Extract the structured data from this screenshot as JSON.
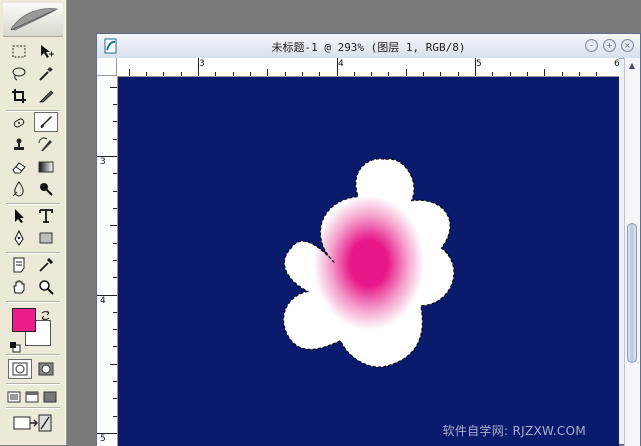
{
  "document": {
    "title": "未标题-1 @ 293% (图层 1, RGB/8)",
    "ruler_h_labels": [
      "3",
      "4",
      "5",
      "6"
    ],
    "ruler_v_labels": [
      "3",
      "4",
      "5"
    ]
  },
  "toolbox": {
    "foreground_color": "#ec1c8c",
    "background_color": "#ffffff",
    "tools": [
      "marquee-icon",
      "move-icon",
      "lasso-icon",
      "magic-wand-icon",
      "crop-icon",
      "slice-icon",
      "healing-brush-icon",
      "brush-icon",
      "clone-stamp-icon",
      "history-brush-icon",
      "eraser-icon",
      "gradient-icon",
      "blur-icon",
      "dodge-icon",
      "path-select-icon",
      "type-icon",
      "pen-icon",
      "shape-icon",
      "notes-icon",
      "eyedropper-icon",
      "hand-icon",
      "zoom-icon"
    ]
  },
  "canvas": {
    "background_color": "#0a1a6c",
    "flower_color": "#ffffff",
    "flower_center_color": "#ec1c8c"
  },
  "watermark": "软件自学网: RJZXW.COM"
}
